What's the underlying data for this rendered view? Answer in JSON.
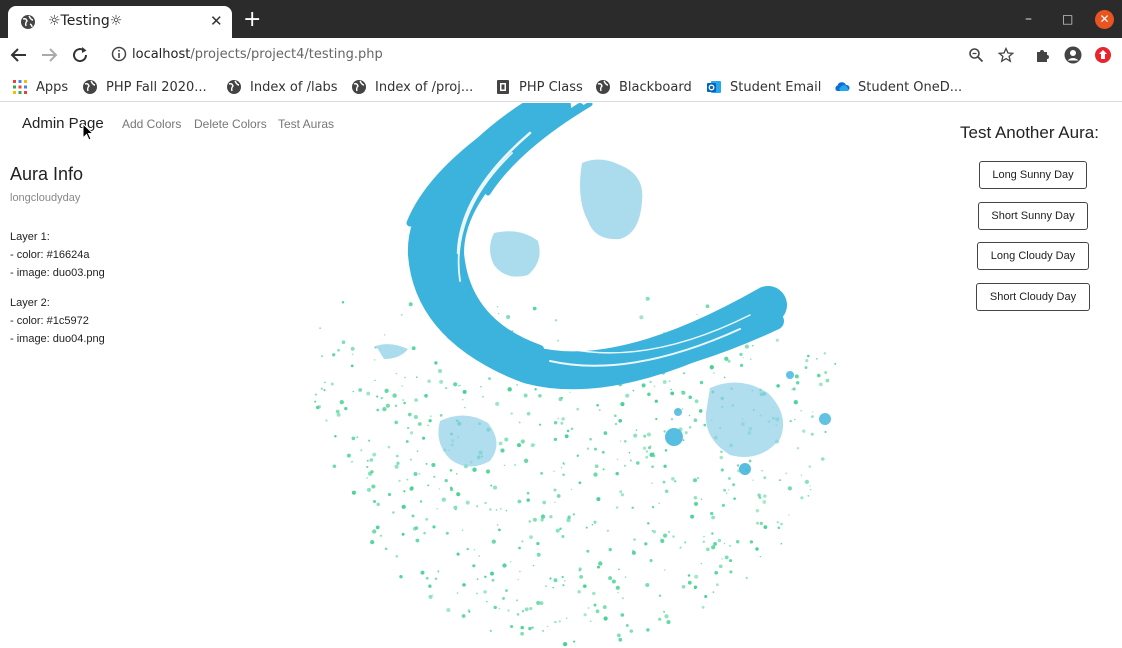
{
  "browser": {
    "tab_title": "☼Testing☼",
    "new_tab_glyph": "+",
    "close_tab_glyph": "✕",
    "window_controls": {
      "minimize": "–",
      "maximize": "□",
      "close": "✕"
    },
    "url_host": "localhost",
    "url_path": "/projects/project4/testing.php",
    "bookmarks": [
      {
        "label": "Apps",
        "icon": "apps-grid-icon"
      },
      {
        "label": "PHP Fall 2020...",
        "icon": "globe-icon"
      },
      {
        "label": "Index of /labs",
        "icon": "globe-icon"
      },
      {
        "label": "Index of /proj...",
        "icon": "globe-icon"
      },
      {
        "label": "PHP Class",
        "icon": "page-icon"
      },
      {
        "label": "Blackboard",
        "icon": "globe-icon"
      },
      {
        "label": "Student Email",
        "icon": "outlook-icon"
      },
      {
        "label": "Student OneD...",
        "icon": "onedrive-cloud-icon"
      }
    ]
  },
  "nav": {
    "brand": "Admin Page",
    "links": [
      "Add Colors",
      "Delete Colors",
      "Test Auras"
    ]
  },
  "aura_info": {
    "title": "Aura Info",
    "name": "longcloudyday",
    "layers": [
      {
        "heading": "Layer 1:",
        "color_line": "- color: #16624a",
        "image_line": "- image: duo03.png"
      },
      {
        "heading": "Layer 2:",
        "color_line": "- color: #1c5972",
        "image_line": "- image: duo04.png"
      }
    ]
  },
  "test_panel": {
    "title": "Test Another Aura:",
    "buttons": [
      "Long Sunny Day",
      "Short Sunny Day",
      "Long Cloudy Day",
      "Short Cloudy Day"
    ]
  },
  "colors": {
    "brush_blue": "#3bb3dc",
    "splash_blue": "#8fd0e8",
    "speckle_green": "#3ccf8e",
    "chrome_dark": "#2b2b2b",
    "close_orange": "#e95420"
  }
}
